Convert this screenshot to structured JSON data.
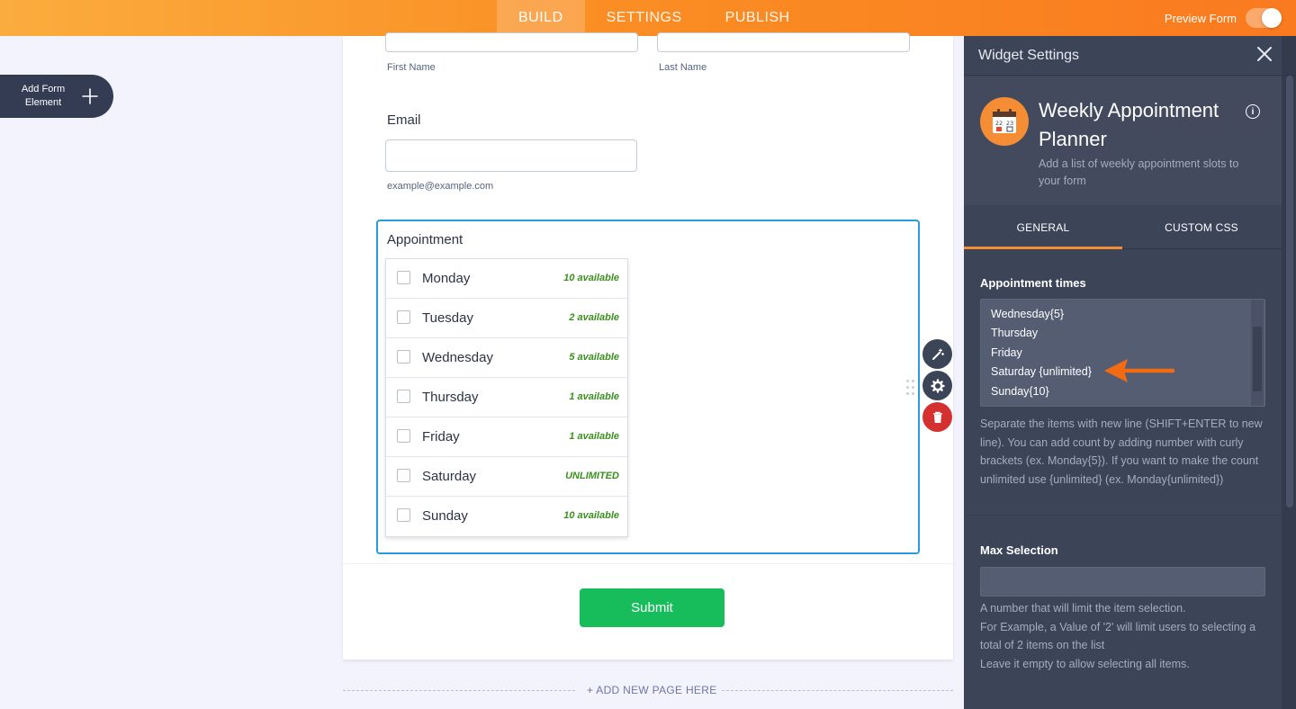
{
  "topbar": {
    "tabs": [
      {
        "label": "BUILD",
        "active": true
      },
      {
        "label": "SETTINGS",
        "active": false
      },
      {
        "label": "PUBLISH",
        "active": false
      }
    ],
    "preview_label": "Preview Form",
    "preview_on": false,
    "gradient_colors": [
      "#fbac3e",
      "#fa7a1f"
    ]
  },
  "add_element": {
    "label_line1": "Add Form",
    "label_line2": "Element",
    "icon": "plus-icon"
  },
  "form": {
    "name_sublabels": {
      "first": "First Name",
      "last": "Last Name"
    },
    "email": {
      "label": "Email",
      "value": "",
      "sublabel": "example@example.com"
    },
    "appointment": {
      "label": "Appointment",
      "options": [
        {
          "day": "Monday",
          "availability": "10 available"
        },
        {
          "day": "Tuesday",
          "availability": "2 available"
        },
        {
          "day": "Wednesday",
          "availability": "5 available"
        },
        {
          "day": "Thursday",
          "availability": "1 available"
        },
        {
          "day": "Friday",
          "availability": "1 available"
        },
        {
          "day": "Saturday",
          "availability": "UNLIMITED"
        },
        {
          "day": "Sunday",
          "availability": "10 available"
        }
      ]
    },
    "submit_label": "Submit",
    "submit_color": "#18bd5b",
    "add_page_label": "+ ADD NEW PAGE HERE"
  },
  "field_tools": [
    {
      "icon": "magic-wand-icon",
      "color": "#3c4458"
    },
    {
      "icon": "gear-icon",
      "color": "#3c4458"
    },
    {
      "icon": "trash-icon",
      "color": "#d3302f"
    }
  ],
  "panel": {
    "title": "Widget Settings",
    "close_icon": "close-icon",
    "widget": {
      "title": "Weekly Appointment Planner",
      "description": "Add a list of weekly appointment slots to your form",
      "icon": "calendar-icon",
      "icon_days": [
        "22",
        "23"
      ]
    },
    "tabs": [
      {
        "label": "GENERAL",
        "active": true
      },
      {
        "label": "CUSTOM CSS",
        "active": false
      }
    ],
    "appointment_times": {
      "label": "Appointment times",
      "lines": [
        "Wednesday{5}",
        "Thursday",
        "Friday",
        "Saturday {unlimited}",
        "Sunday{10}"
      ],
      "help": "Separate the items with new line (SHIFT+ENTER to new line). You can add count by adding number with curly brackets (ex. Monday{5}). If you want to make the count unlimited use {unlimited} (ex. Monday{unlimited})"
    },
    "max_selection": {
      "label": "Max Selection",
      "value": "",
      "help_lines": [
        "A number that will limit the item selection.",
        "For Example, a Value of '2' will limit users to selecting a total of 2 items on the list",
        "Leave it empty to allow selecting all items."
      ]
    },
    "accent_color": "#f48d34"
  }
}
